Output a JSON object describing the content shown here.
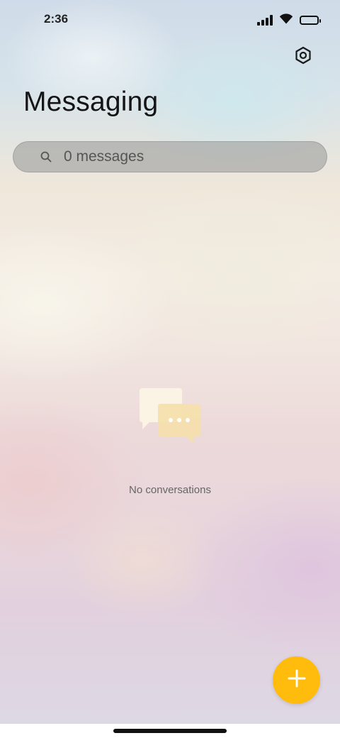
{
  "status_bar": {
    "time": "2:36",
    "icons": [
      "signal-icon",
      "wifi-icon",
      "battery-icon"
    ]
  },
  "header": {
    "title": "Messaging",
    "settings_icon": "settings-icon"
  },
  "search": {
    "placeholder": "0 messages",
    "value": "",
    "icon": "search-icon"
  },
  "empty_state": {
    "icon": "chat-bubbles-icon",
    "text": "No conversations"
  },
  "fab": {
    "icon": "plus-icon",
    "color": "#ffbc0d"
  }
}
